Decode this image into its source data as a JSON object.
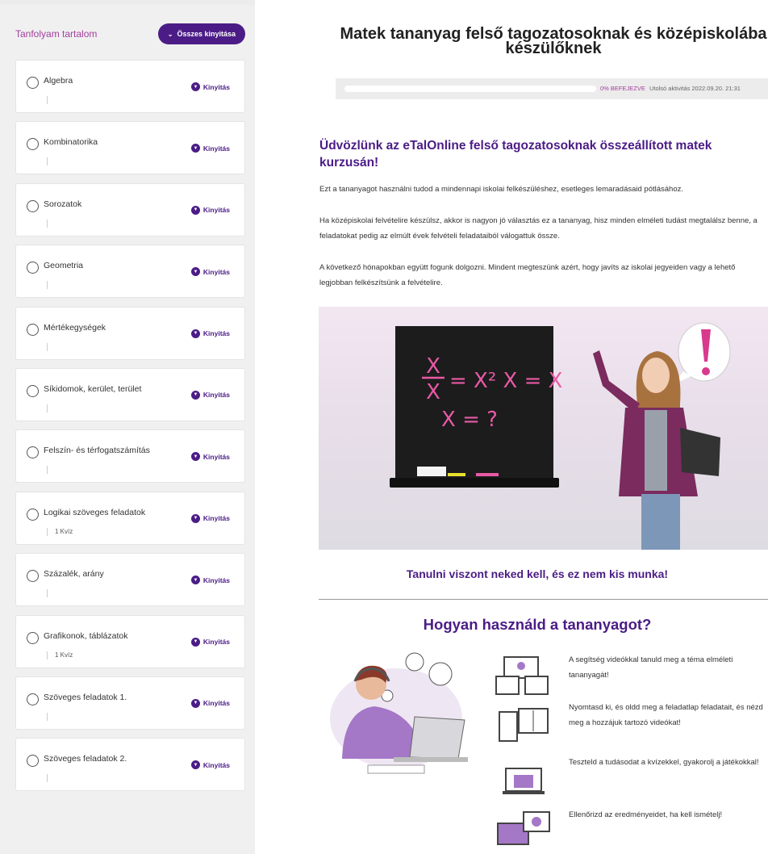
{
  "sidebar": {
    "title": "Tanfolyam tartalom",
    "expand_all_label": "Összes kinyitása",
    "open_label": "Kinyitás",
    "lessons": [
      {
        "name": "Algebra",
        "meta": ""
      },
      {
        "name": "Kombinatorika",
        "meta": ""
      },
      {
        "name": "Sorozatok",
        "meta": ""
      },
      {
        "name": "Geometria",
        "meta": ""
      },
      {
        "name": "Mértékegységek",
        "meta": ""
      },
      {
        "name": "Síkidomok, kerület, terület",
        "meta": ""
      },
      {
        "name": "Felszín- és térfogatszámítás",
        "meta": ""
      },
      {
        "name": "Logikai szöveges feladatok",
        "meta": "1 Kvíz"
      },
      {
        "name": "Százalék, arány",
        "meta": ""
      },
      {
        "name": "Grafikonok, táblázatok",
        "meta": "1 Kvíz"
      },
      {
        "name": "Szöveges feladatok 1.",
        "meta": ""
      },
      {
        "name": "Szöveges feladatok 2.",
        "meta": ""
      }
    ]
  },
  "main": {
    "title": "Matek tananyag felső tagozatosoknak és középiskolába készülőknek",
    "progress": {
      "percent": 0,
      "label": "0% BEFEJEZVE",
      "last_activity": "Utolsó aktivitás 2022.09.20. 21:31"
    },
    "welcome": "Üdvözlünk az eTalOnline felső tagozatosoknak összeállított matek kurzusán!",
    "paragraphs": [
      "Ezt a tananyagot használni tudod a mindennapi iskolai felkészüléshez, esetleges lemaradásaid pótlásához.",
      "Ha középiskolai felvételire készülsz, akkor is nagyon jó választás ez a tananyag, hisz minden elméleti tudást megtalálsz benne, a feladatokat pedig az elmúlt évek felvételi feladataiból válogattuk össze.",
      "A következő hónapokban együtt fogunk dolgozni. Mindent megteszünk azért, hogy javíts az iskolai jegyeiden vagy a lehető legjobban felkészítsünk a felvételire."
    ],
    "board": {
      "line1_num": "X",
      "line1_den": "X",
      "line1_rest": "= X² X = X",
      "line2": "X = ?"
    },
    "subheading": "Tanulni viszont neked kell, és ez nem kis munka!",
    "howto_title": "Hogyan használd a tananyagot?",
    "howto_steps": [
      "A segítség videókkal tanuld meg a téma elméleti tananyagát!",
      "Nyomtasd ki, és oldd meg a feladatlap feladatait, és nézd meg a hozzájuk tartozó videókat!",
      "Teszteld a tudásodat a kvízekkel, gyakorolj a játékokkal!",
      "Ellenőrizd az eredményeidet, ha kell ismételj!"
    ],
    "colors": {
      "brand": "#4b1c86",
      "accent": "#a23f9e",
      "board_chalk": "#e85aa6"
    }
  }
}
